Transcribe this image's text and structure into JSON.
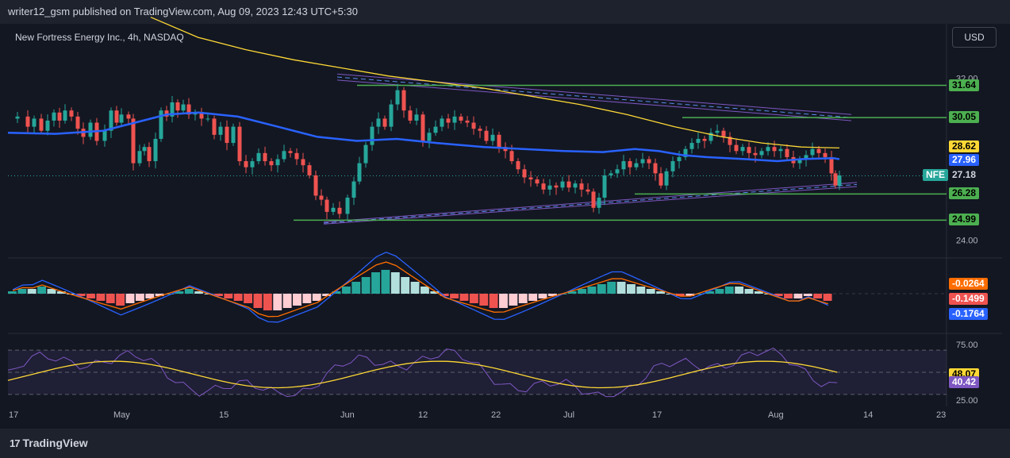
{
  "header": {
    "published": "writer12_gsm published on TradingView.com, Aug 09, 2023 12:43 UTC+5:30"
  },
  "legend": {
    "title": "New Fortress Energy Inc., 4h, NASDAQ"
  },
  "currency_button": "USD",
  "footer": {
    "brand": "TradingView"
  },
  "colors": {
    "background": "#131722",
    "up": "#26a69a",
    "down": "#ef5350",
    "ema_blue": "#2962ff",
    "ema_yellow": "#fdd835",
    "channel": "#7e57c2",
    "level": "#4caf50",
    "macd_orange": "#ff6d00",
    "rsi_line": "#7e57c2"
  },
  "chart_data": [
    {
      "type": "candlestick",
      "title": "New Fortress Energy Inc., 4h, NASDAQ",
      "symbol": "NFE",
      "last_price": "27.18",
      "x_ticks": [
        "17",
        "May",
        "15",
        "Jun",
        "12",
        "22",
        "Jul",
        "17",
        "Aug",
        "14",
        "23"
      ],
      "y_ticks": [
        "32.00",
        "24.00"
      ],
      "ylim": [
        23.4,
        33.5
      ],
      "levels": [
        {
          "label": "31.64",
          "value": 31.64
        },
        {
          "label": "30.05",
          "value": 30.05
        },
        {
          "label": "26.28",
          "value": 26.28
        },
        {
          "label": "24.99",
          "value": 24.99
        }
      ],
      "ema_badges": [
        {
          "label": "28.62",
          "value": 28.62,
          "color": "#fdd835"
        },
        {
          "label": "27.96",
          "value": 27.96,
          "color": "#2962ff"
        }
      ],
      "price_path": [
        [
          0,
          30.0
        ],
        [
          12,
          30.1
        ],
        [
          25,
          29.6
        ],
        [
          33,
          30.0
        ],
        [
          42,
          29.4
        ],
        [
          50,
          29.9
        ],
        [
          58,
          30.3
        ],
        [
          65,
          29.9
        ],
        [
          72,
          30.4
        ],
        [
          80,
          30.1
        ],
        [
          88,
          29.5
        ],
        [
          95,
          29.1
        ],
        [
          104,
          29.8
        ],
        [
          112,
          28.9
        ],
        [
          122,
          29.4
        ],
        [
          130,
          30.4
        ],
        [
          137,
          29.8
        ],
        [
          143,
          30.2
        ],
        [
          152,
          30.0
        ],
        [
          158,
          27.8
        ],
        [
          166,
          28.4
        ],
        [
          172,
          28.6
        ],
        [
          178,
          27.9
        ],
        [
          186,
          29.0
        ],
        [
          193,
          30.4
        ],
        [
          200,
          30.1
        ],
        [
          207,
          30.8
        ],
        [
          214,
          30.4
        ],
        [
          221,
          30.7
        ],
        [
          228,
          30.2
        ],
        [
          236,
          30.3
        ],
        [
          244,
          30.0
        ],
        [
          252,
          30.0
        ],
        [
          260,
          29.2
        ],
        [
          268,
          29.6
        ],
        [
          276,
          28.8
        ],
        [
          284,
          29.6
        ],
        [
          292,
          27.9
        ],
        [
          300,
          27.6
        ],
        [
          308,
          27.9
        ],
        [
          316,
          28.3
        ],
        [
          324,
          27.9
        ],
        [
          332,
          27.7
        ],
        [
          340,
          28.0
        ],
        [
          348,
          28.4
        ],
        [
          356,
          28.3
        ],
        [
          364,
          28.0
        ],
        [
          372,
          27.7
        ],
        [
          380,
          27.2
        ],
        [
          388,
          26.2
        ],
        [
          395,
          26.0
        ],
        [
          402,
          25.4
        ],
        [
          410,
          25.6
        ],
        [
          418,
          25.3
        ],
        [
          428,
          26.1
        ],
        [
          436,
          26.9
        ],
        [
          443,
          27.8
        ],
        [
          451,
          28.7
        ],
        [
          459,
          29.6
        ],
        [
          467,
          30.0
        ],
        [
          475,
          29.6
        ],
        [
          483,
          30.7
        ],
        [
          491,
          31.4
        ],
        [
          499,
          30.4
        ],
        [
          507,
          29.9
        ],
        [
          515,
          30.2
        ],
        [
          523,
          28.9
        ],
        [
          531,
          29.3
        ],
        [
          539,
          29.6
        ],
        [
          547,
          30.0
        ],
        [
          555,
          29.8
        ],
        [
          563,
          30.1
        ],
        [
          571,
          29.9
        ],
        [
          579,
          29.8
        ],
        [
          587,
          29.5
        ],
        [
          595,
          29.4
        ],
        [
          603,
          28.9
        ],
        [
          611,
          29.2
        ],
        [
          619,
          28.6
        ],
        [
          627,
          28.4
        ],
        [
          635,
          27.9
        ],
        [
          643,
          27.5
        ],
        [
          651,
          27.1
        ],
        [
          659,
          27.0
        ],
        [
          667,
          26.8
        ],
        [
          675,
          26.5
        ],
        [
          683,
          26.7
        ],
        [
          691,
          26.6
        ],
        [
          699,
          26.9
        ],
        [
          707,
          26.6
        ],
        [
          715,
          26.8
        ],
        [
          723,
          26.5
        ],
        [
          731,
          26.4
        ],
        [
          738,
          25.6
        ],
        [
          745,
          26.1
        ],
        [
          752,
          27.2
        ],
        [
          760,
          27.3
        ],
        [
          768,
          27.5
        ],
        [
          776,
          27.9
        ],
        [
          784,
          27.6
        ],
        [
          792,
          27.8
        ],
        [
          800,
          28.0
        ],
        [
          808,
          27.8
        ],
        [
          816,
          27.3
        ],
        [
          823,
          26.7
        ],
        [
          830,
          27.4
        ],
        [
          838,
          27.9
        ],
        [
          846,
          28.1
        ],
        [
          854,
          28.5
        ],
        [
          862,
          28.8
        ],
        [
          870,
          29.0
        ],
        [
          878,
          28.9
        ],
        [
          886,
          29.3
        ],
        [
          894,
          29.4
        ],
        [
          902,
          29.1
        ],
        [
          910,
          28.7
        ],
        [
          918,
          28.4
        ],
        [
          926,
          28.6
        ],
        [
          934,
          28.3
        ],
        [
          942,
          28.2
        ],
        [
          950,
          28.4
        ],
        [
          958,
          28.6
        ],
        [
          966,
          28.4
        ],
        [
          974,
          28.5
        ],
        [
          982,
          28.1
        ],
        [
          990,
          27.8
        ],
        [
          998,
          28.0
        ],
        [
          1006,
          28.2
        ],
        [
          1014,
          28.5
        ],
        [
          1022,
          28.3
        ],
        [
          1030,
          28.1
        ],
        [
          1038,
          27.3
        ],
        [
          1043,
          26.7
        ],
        [
          1048,
          27.2
        ]
      ],
      "series": [
        {
          "name": "",
          "color": "#2962ff",
          "values": [
            [
              0,
              29.3
            ],
            [
              60,
              29.25
            ],
            [
              120,
              29.4
            ],
            [
              170,
              29.9
            ],
            [
              200,
              30.2
            ],
            [
              240,
              30.3
            ],
            [
              290,
              30.1
            ],
            [
              340,
              29.6
            ],
            [
              390,
              29.1
            ],
            [
              440,
              28.9
            ],
            [
              490,
              29.0
            ],
            [
              540,
              28.8
            ],
            [
              600,
              28.6
            ],
            [
              650,
              28.5
            ],
            [
              700,
              28.4
            ],
            [
              750,
              28.35
            ],
            [
              790,
              28.5
            ],
            [
              820,
              28.4
            ],
            [
              850,
              28.2
            ],
            [
              880,
              28.1
            ],
            [
              930,
              28.0
            ],
            [
              970,
              27.9
            ],
            [
              1000,
              28.0
            ],
            [
              1040,
              28.05
            ],
            [
              1048,
              28.0
            ]
          ]
        },
        {
          "name": "",
          "color": "#fdd835",
          "values": [
            [
              180,
              35.0
            ],
            [
              240,
              34.0
            ],
            [
              300,
              33.4
            ],
            [
              360,
              32.9
            ],
            [
              420,
              32.5
            ],
            [
              480,
              32.1
            ],
            [
              540,
              31.8
            ],
            [
              600,
              31.5
            ],
            [
              660,
              31.1
            ],
            [
              720,
              30.7
            ],
            [
              780,
              30.2
            ],
            [
              840,
              29.6
            ],
            [
              900,
              29.1
            ],
            [
              950,
              28.8
            ],
            [
              1000,
              28.6
            ],
            [
              1048,
              28.55
            ]
          ]
        }
      ]
    },
    {
      "type": "line",
      "title": "",
      "series": [
        {
          "name": "",
          "color": "#ff6d00",
          "label": "-0.0264",
          "value": -0.0264
        },
        {
          "name": "",
          "color": "#ef5350",
          "label": "-0.1499",
          "value": -0.1499
        },
        {
          "name": "",
          "color": "#2962ff",
          "label": "-0.1764",
          "value": -0.1764
        }
      ]
    },
    {
      "type": "line",
      "title": "",
      "y_ticks": [
        "75.00",
        "25.00"
      ],
      "ylim": [
        22,
        78
      ],
      "series": [
        {
          "name": "",
          "color": "#fdd835",
          "label": "48.07",
          "value": 48.07
        },
        {
          "name": "",
          "color": "#7e57c2",
          "label": "40.42",
          "value": 40.42
        }
      ]
    }
  ]
}
